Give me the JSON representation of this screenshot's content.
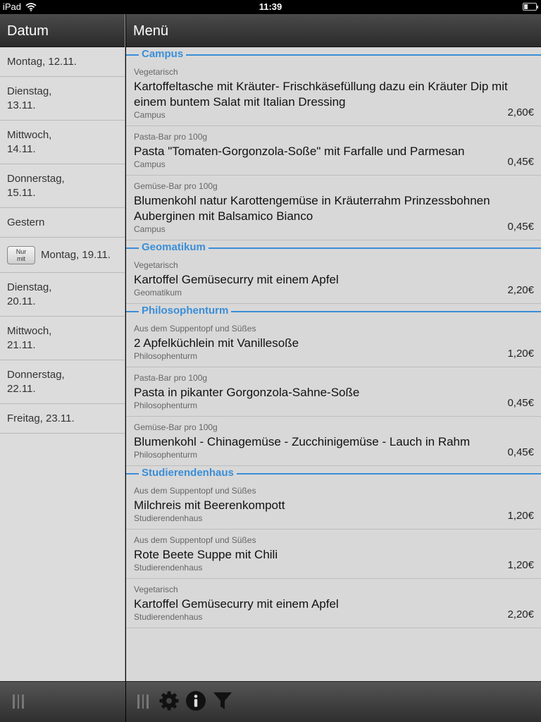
{
  "status_bar": {
    "device": "iPad",
    "time": "11:39"
  },
  "sidebar": {
    "title": "Datum",
    "items": [
      {
        "label": "Montag, 12.11."
      },
      {
        "label": "Dienstag,\n13.11."
      },
      {
        "label": "Mittwoch,\n14.11."
      },
      {
        "label": "Donnerstag,\n15.11."
      },
      {
        "label": "Gestern"
      },
      {
        "label": "Montag, 19.11.",
        "badge": "Nur\nmit"
      },
      {
        "label": "Dienstag,\n20.11."
      },
      {
        "label": "Mittwoch,\n21.11."
      },
      {
        "label": "Donnerstag,\n22.11."
      },
      {
        "label": "Freitag, 23.11."
      }
    ]
  },
  "main": {
    "title": "Menü",
    "sections": [
      {
        "title": "Campus",
        "items": [
          {
            "category": "Vegetarisch",
            "name": "Kartoffeltasche mit Kräuter- Frischkäsefüllung dazu ein Kräuter Dip mit einem buntem Salat mit Italian Dressing",
            "location": "Campus",
            "price": "2,60€"
          },
          {
            "category": "Pasta-Bar pro 100g",
            "name": "Pasta \"Tomaten-Gorgonzola-Soße\" mit Farfalle und Parmesan",
            "location": "Campus",
            "price": "0,45€"
          },
          {
            "category": "Gemüse-Bar pro 100g",
            "name": "Blumenkohl natur Karottengemüse in Kräuterrahm Prinzessbohnen Auberginen mit Balsamico Bianco",
            "location": "Campus",
            "price": "0,45€"
          }
        ]
      },
      {
        "title": "Geomatikum",
        "items": [
          {
            "category": "Vegetarisch",
            "name": "Kartoffel Gemüsecurry mit einem Apfel",
            "location": "Geomatikum",
            "price": "2,20€"
          }
        ]
      },
      {
        "title": "Philosophenturm",
        "items": [
          {
            "category": "Aus dem Suppentopf und Süßes",
            "name": "2 Apfelküchlein mit Vanillesoße",
            "location": "Philosophenturm",
            "price": "1,20€"
          },
          {
            "category": "Pasta-Bar pro 100g",
            "name": "Pasta in pikanter Gorgonzola-Sahne-Soße",
            "location": "Philosophenturm",
            "price": "0,45€"
          },
          {
            "category": "Gemüse-Bar pro 100g",
            "name": "Blumenkohl - Chinagemüse - Zucchinigemüse - Lauch in Rahm",
            "location": "Philosophenturm",
            "price": "0,45€"
          }
        ]
      },
      {
        "title": "Studierendenhaus",
        "items": [
          {
            "category": "Aus dem Suppentopf und Süßes",
            "name": "Milchreis mit Beerenkompott",
            "location": "Studierendenhaus",
            "price": "1,20€"
          },
          {
            "category": "Aus dem Suppentopf und Süßes",
            "name": "Rote Beete Suppe mit Chili",
            "location": "Studierendenhaus",
            "price": "1,20€"
          },
          {
            "category": "Vegetarisch",
            "name": "Kartoffel Gemüsecurry mit einem Apfel",
            "location": "Studierendenhaus",
            "price": "2,20€"
          }
        ]
      }
    ]
  },
  "toolbar": {
    "icons": [
      "settings-gear-icon",
      "info-icon",
      "filter-funnel-icon"
    ]
  },
  "colors": {
    "accent": "#3a8ed8",
    "header_dark": "#2b2b2b",
    "panel_bg": "#d8d8d8"
  }
}
